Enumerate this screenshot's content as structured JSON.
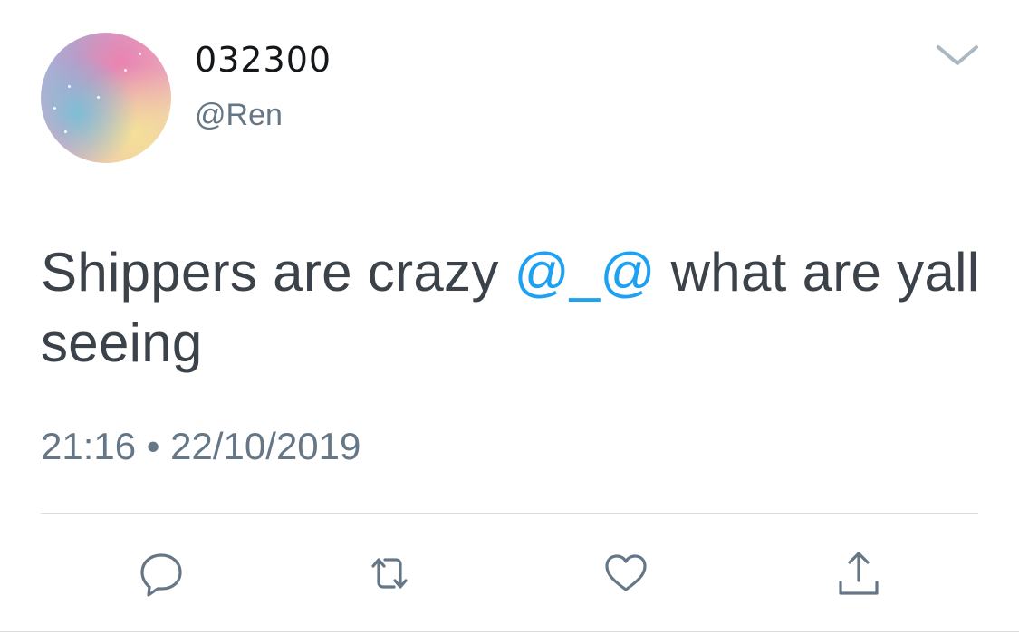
{
  "tweet": {
    "display_name": "032300",
    "handle": "@Ren",
    "text_before": "Shippers are crazy ",
    "mention": "@_@",
    "text_after": " what are yall seeing",
    "time": "21:16",
    "separator": "•",
    "date": "22/10/2019"
  },
  "actions": [
    {
      "name": "reply",
      "icon": "reply-icon"
    },
    {
      "name": "retweet",
      "icon": "retweet-icon"
    },
    {
      "name": "like",
      "icon": "heart-icon"
    },
    {
      "name": "share",
      "icon": "share-icon"
    }
  ],
  "colors": {
    "text": "#3b4249",
    "secondary": "#657786",
    "link": "#1da1f2",
    "icon": "#657786"
  }
}
